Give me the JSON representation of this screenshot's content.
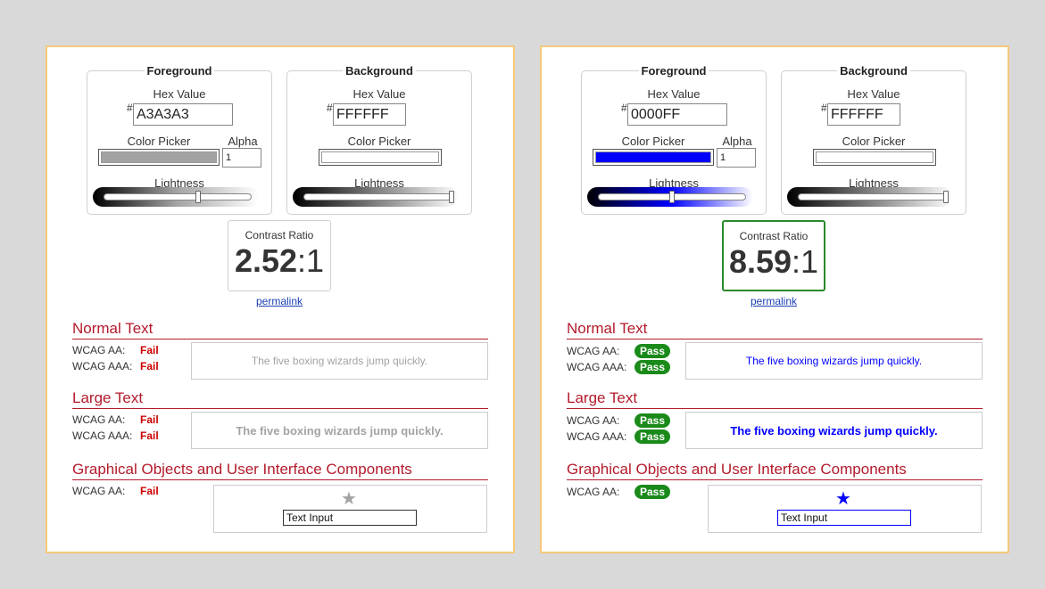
{
  "panels": [
    {
      "foreground": {
        "legend": "Foreground",
        "hex_label": "Hex Value",
        "hash": "#",
        "hex_value": "A3A3A3",
        "picker_label": "Color Picker",
        "alpha_label": "Alpha",
        "alpha_value": "1",
        "lightness_label": "Lightness",
        "color": "#a3a3a3",
        "lightness": 0.64
      },
      "background": {
        "legend": "Background",
        "hex_label": "Hex Value",
        "hash": "#",
        "hex_value": "FFFFFF",
        "picker_label": "Color Picker",
        "lightness_label": "Lightness",
        "color": "#ffffff",
        "lightness": 1.0
      },
      "contrast": {
        "title": "Contrast Ratio",
        "value_bold": "2.52",
        "value_rest": ":1",
        "border": "#cfcfcf"
      },
      "permalink": "permalink",
      "normal": {
        "heading": "Normal Text",
        "aa_label": "WCAG AA:",
        "aa": "Fail",
        "aaa_label": "WCAG AAA:",
        "aaa": "Fail",
        "sample": "The five boxing wizards jump quickly."
      },
      "large": {
        "heading": "Large Text",
        "aa_label": "WCAG AA:",
        "aa": "Fail",
        "aaa_label": "WCAG AAA:",
        "aaa": "Fail",
        "sample": "The five boxing wizards jump quickly."
      },
      "graphics": {
        "heading": "Graphical Objects and User Interface Components",
        "aa_label": "WCAG AA:",
        "aa": "Fail",
        "input": "Text Input",
        "icon": "star-icon"
      }
    },
    {
      "foreground": {
        "legend": "Foreground",
        "hex_label": "Hex Value",
        "hash": "#",
        "hex_value": "0000FF",
        "picker_label": "Color Picker",
        "alpha_label": "Alpha",
        "alpha_value": "1",
        "lightness_label": "Lightness",
        "color": "#0000ff",
        "lightness": 0.5
      },
      "background": {
        "legend": "Background",
        "hex_label": "Hex Value",
        "hash": "#",
        "hex_value": "FFFFFF",
        "picker_label": "Color Picker",
        "lightness_label": "Lightness",
        "color": "#ffffff",
        "lightness": 1.0
      },
      "contrast": {
        "title": "Contrast Ratio",
        "value_bold": "8.59",
        "value_rest": ":1",
        "border": "#2a8a2a"
      },
      "permalink": "permalink",
      "normal": {
        "heading": "Normal Text",
        "aa_label": "WCAG AA:",
        "aa": "Pass",
        "aaa_label": "WCAG AAA:",
        "aaa": "Pass",
        "sample": "The five boxing wizards jump quickly."
      },
      "large": {
        "heading": "Large Text",
        "aa_label": "WCAG AA:",
        "aa": "Pass",
        "aaa_label": "WCAG AAA:",
        "aaa": "Pass",
        "sample": "The five boxing wizards jump quickly."
      },
      "graphics": {
        "heading": "Graphical Objects and User Interface Components",
        "aa_label": "WCAG AA:",
        "aa": "Pass",
        "input": "Text Input",
        "icon": "star-icon"
      }
    }
  ]
}
